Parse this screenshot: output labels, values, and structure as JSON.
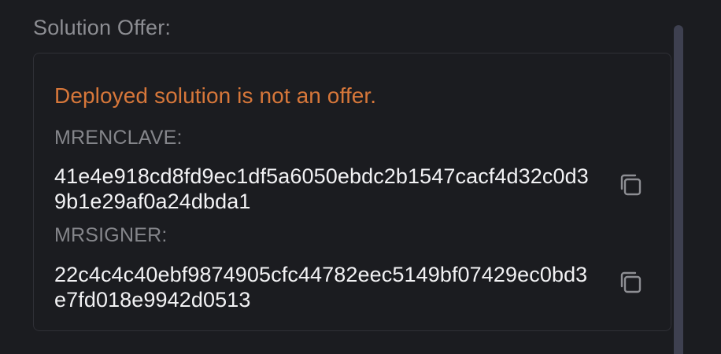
{
  "section": {
    "title": "Solution Offer:"
  },
  "card": {
    "warning": "Deployed solution is not an offer.",
    "fields": [
      {
        "label": "MRENCLAVE:",
        "value": "41e4e918cd8fd9ec1df5a6050ebdc2b1547cacf4d32c0d39b1e29af0a24dbda1",
        "icon": "copy-icon"
      },
      {
        "label": "MRSIGNER:",
        "value": "22c4c4c40ebf9874905cfc44782eec5149bf07429ec0bd3e7fd018e9942d0513",
        "icon": "copy-icon"
      }
    ]
  },
  "colors": {
    "background": "#1b1c20",
    "warning": "#d7773a",
    "label": "#85868b",
    "value": "#f2f2f4",
    "border": "#2f3036",
    "scrollbar": "#3e4050"
  }
}
